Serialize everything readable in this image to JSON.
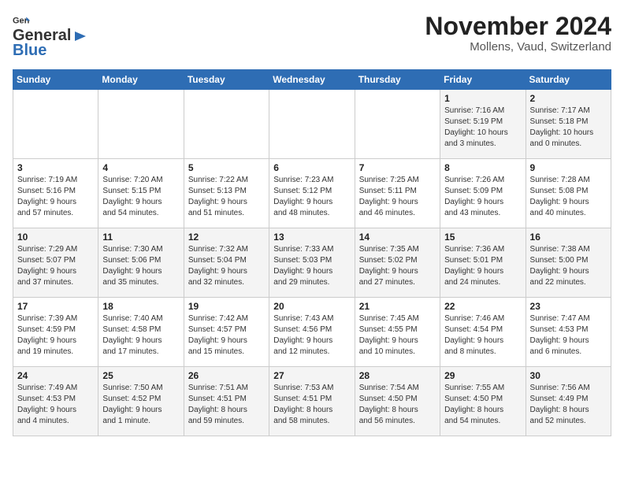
{
  "header": {
    "logo_general": "General",
    "logo_blue": "Blue",
    "month_title": "November 2024",
    "location": "Mollens, Vaud, Switzerland"
  },
  "weekdays": [
    "Sunday",
    "Monday",
    "Tuesday",
    "Wednesday",
    "Thursday",
    "Friday",
    "Saturday"
  ],
  "weeks": [
    [
      {
        "day": "",
        "info": ""
      },
      {
        "day": "",
        "info": ""
      },
      {
        "day": "",
        "info": ""
      },
      {
        "day": "",
        "info": ""
      },
      {
        "day": "",
        "info": ""
      },
      {
        "day": "1",
        "info": "Sunrise: 7:16 AM\nSunset: 5:19 PM\nDaylight: 10 hours\nand 3 minutes."
      },
      {
        "day": "2",
        "info": "Sunrise: 7:17 AM\nSunset: 5:18 PM\nDaylight: 10 hours\nand 0 minutes."
      }
    ],
    [
      {
        "day": "3",
        "info": "Sunrise: 7:19 AM\nSunset: 5:16 PM\nDaylight: 9 hours\nand 57 minutes."
      },
      {
        "day": "4",
        "info": "Sunrise: 7:20 AM\nSunset: 5:15 PM\nDaylight: 9 hours\nand 54 minutes."
      },
      {
        "day": "5",
        "info": "Sunrise: 7:22 AM\nSunset: 5:13 PM\nDaylight: 9 hours\nand 51 minutes."
      },
      {
        "day": "6",
        "info": "Sunrise: 7:23 AM\nSunset: 5:12 PM\nDaylight: 9 hours\nand 48 minutes."
      },
      {
        "day": "7",
        "info": "Sunrise: 7:25 AM\nSunset: 5:11 PM\nDaylight: 9 hours\nand 46 minutes."
      },
      {
        "day": "8",
        "info": "Sunrise: 7:26 AM\nSunset: 5:09 PM\nDaylight: 9 hours\nand 43 minutes."
      },
      {
        "day": "9",
        "info": "Sunrise: 7:28 AM\nSunset: 5:08 PM\nDaylight: 9 hours\nand 40 minutes."
      }
    ],
    [
      {
        "day": "10",
        "info": "Sunrise: 7:29 AM\nSunset: 5:07 PM\nDaylight: 9 hours\nand 37 minutes."
      },
      {
        "day": "11",
        "info": "Sunrise: 7:30 AM\nSunset: 5:06 PM\nDaylight: 9 hours\nand 35 minutes."
      },
      {
        "day": "12",
        "info": "Sunrise: 7:32 AM\nSunset: 5:04 PM\nDaylight: 9 hours\nand 32 minutes."
      },
      {
        "day": "13",
        "info": "Sunrise: 7:33 AM\nSunset: 5:03 PM\nDaylight: 9 hours\nand 29 minutes."
      },
      {
        "day": "14",
        "info": "Sunrise: 7:35 AM\nSunset: 5:02 PM\nDaylight: 9 hours\nand 27 minutes."
      },
      {
        "day": "15",
        "info": "Sunrise: 7:36 AM\nSunset: 5:01 PM\nDaylight: 9 hours\nand 24 minutes."
      },
      {
        "day": "16",
        "info": "Sunrise: 7:38 AM\nSunset: 5:00 PM\nDaylight: 9 hours\nand 22 minutes."
      }
    ],
    [
      {
        "day": "17",
        "info": "Sunrise: 7:39 AM\nSunset: 4:59 PM\nDaylight: 9 hours\nand 19 minutes."
      },
      {
        "day": "18",
        "info": "Sunrise: 7:40 AM\nSunset: 4:58 PM\nDaylight: 9 hours\nand 17 minutes."
      },
      {
        "day": "19",
        "info": "Sunrise: 7:42 AM\nSunset: 4:57 PM\nDaylight: 9 hours\nand 15 minutes."
      },
      {
        "day": "20",
        "info": "Sunrise: 7:43 AM\nSunset: 4:56 PM\nDaylight: 9 hours\nand 12 minutes."
      },
      {
        "day": "21",
        "info": "Sunrise: 7:45 AM\nSunset: 4:55 PM\nDaylight: 9 hours\nand 10 minutes."
      },
      {
        "day": "22",
        "info": "Sunrise: 7:46 AM\nSunset: 4:54 PM\nDaylight: 9 hours\nand 8 minutes."
      },
      {
        "day": "23",
        "info": "Sunrise: 7:47 AM\nSunset: 4:53 PM\nDaylight: 9 hours\nand 6 minutes."
      }
    ],
    [
      {
        "day": "24",
        "info": "Sunrise: 7:49 AM\nSunset: 4:53 PM\nDaylight: 9 hours\nand 4 minutes."
      },
      {
        "day": "25",
        "info": "Sunrise: 7:50 AM\nSunset: 4:52 PM\nDaylight: 9 hours\nand 1 minute."
      },
      {
        "day": "26",
        "info": "Sunrise: 7:51 AM\nSunset: 4:51 PM\nDaylight: 8 hours\nand 59 minutes."
      },
      {
        "day": "27",
        "info": "Sunrise: 7:53 AM\nSunset: 4:51 PM\nDaylight: 8 hours\nand 58 minutes."
      },
      {
        "day": "28",
        "info": "Sunrise: 7:54 AM\nSunset: 4:50 PM\nDaylight: 8 hours\nand 56 minutes."
      },
      {
        "day": "29",
        "info": "Sunrise: 7:55 AM\nSunset: 4:50 PM\nDaylight: 8 hours\nand 54 minutes."
      },
      {
        "day": "30",
        "info": "Sunrise: 7:56 AM\nSunset: 4:49 PM\nDaylight: 8 hours\nand 52 minutes."
      }
    ]
  ]
}
